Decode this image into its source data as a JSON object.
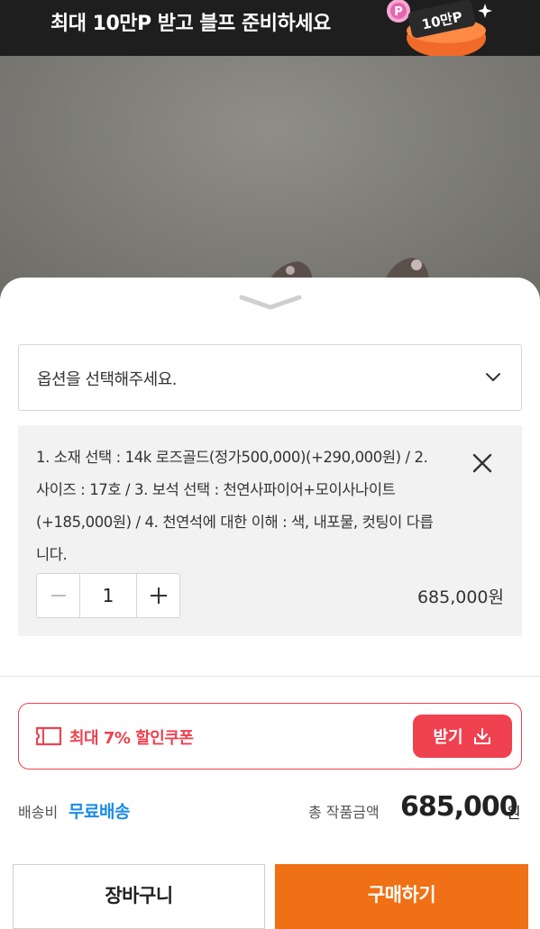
{
  "banner": {
    "text": "최대 10만P 받고 블프 준비하세요",
    "badge": "10만P",
    "coin_letter": "P"
  },
  "options": {
    "select_placeholder": "옵션을 선택해주세요.",
    "selected_item": {
      "description": "1. 소재 선택 : 14k 로즈골드(정가500,000)(+290,000원) / 2. 사이즈 : 17호 / 3. 보석 선택 : 천연사파이어+모이사나이트 (+185,000원) / 4. 천연석에 대한 이해 : 색, 내포물, 컷팅이 다릅니다.",
      "quantity": "1",
      "price": "685,000원"
    }
  },
  "coupon": {
    "label": "최대 7% 할인쿠폰",
    "button_label": "받기"
  },
  "summary": {
    "shipping_label": "배송비",
    "shipping_value": "무료배송",
    "total_label": "총 작품금액",
    "total_value": "685,000",
    "total_unit": "원"
  },
  "actions": {
    "cart_label": "장바구니",
    "buy_label": "구매하기"
  },
  "colors": {
    "accent_red": "#ef4150",
    "buy_orange": "#f07015",
    "free_shipping_blue": "#1a8be8",
    "banner_bg": "#1e1e1e"
  }
}
